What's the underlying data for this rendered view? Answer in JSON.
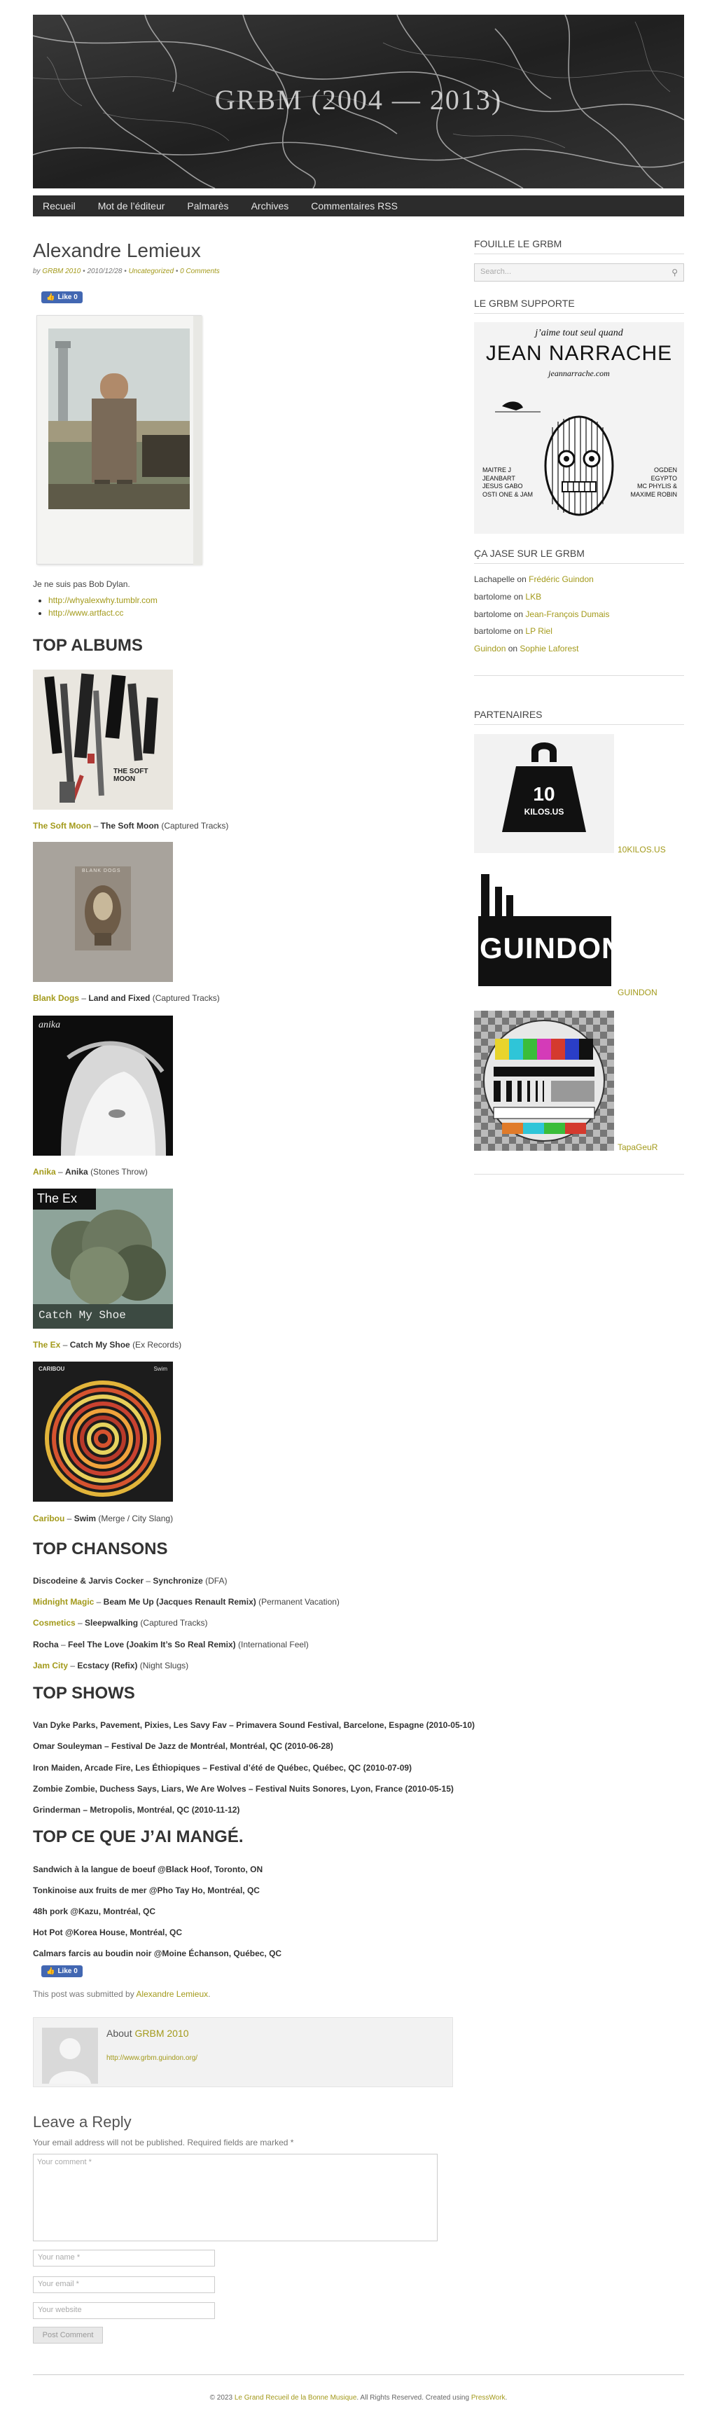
{
  "site": {
    "title": "GRBM (2004 — 2013)"
  },
  "nav": [
    "Recueil",
    "Mot de l’éditeur",
    "Palmarès",
    "Archives",
    "Commentaires RSS"
  ],
  "post": {
    "title": "Alexandre Lemieux",
    "meta_by": "by",
    "meta_author": "GRBM 2010",
    "meta_date": "2010/12/28",
    "meta_category": "Uncategorized",
    "meta_comments": "0 Comments",
    "fb_like": "Like 0",
    "intro": "Je ne suis pas Bob Dylan.",
    "links": [
      "http://whyalexwhy.tumblr.com",
      "http://www.artfact.cc"
    ],
    "top_albums_heading": "TOP ALBUMS",
    "albums": [
      {
        "artist": "The Soft Moon",
        "title": "The Soft Moon",
        "label": "(Captured Tracks)",
        "cover_text": "THE SOFT MOON"
      },
      {
        "artist": "Blank Dogs",
        "title": "Land and Fixed",
        "label": "(Captured Tracks)",
        "cover_text": "BLANK DOGS"
      },
      {
        "artist": "Anika",
        "title": "Anika",
        "label": "(Stones Throw)",
        "cover_text": "anika"
      },
      {
        "artist": "The Ex",
        "title": "Catch My Shoe",
        "label": "(Ex Records)",
        "cover_text": "The Ex",
        "cover_sub": "Catch My Shoe"
      },
      {
        "artist": "Caribou",
        "title": "Swim",
        "label": "(Merge / City Slang)",
        "cover_text": "CARIBOU",
        "cover_sub": "Swim"
      }
    ],
    "top_chansons_heading": "TOP CHANSONS",
    "chansons": [
      {
        "artist": "Discodeine & Jarvis Cocker",
        "artist_link": false,
        "title": "Synchronize",
        "label": "(DFA)"
      },
      {
        "artist": "Midnight Magic",
        "artist_link": true,
        "title": "Beam Me Up (Jacques Renault Remix)",
        "label": "(Permanent Vacation)"
      },
      {
        "artist": "Cosmetics",
        "artist_link": true,
        "title": "Sleepwalking",
        "label": "(Captured Tracks)"
      },
      {
        "artist": "Rocha",
        "artist_link": false,
        "title": "Feel The Love (Joakim It’s So Real Remix)",
        "label": "(International Feel)"
      },
      {
        "artist": "Jam City",
        "artist_link": true,
        "title": "Ecstacy (Refix)",
        "label": "(Night Slugs)"
      }
    ],
    "top_shows_heading": "TOP SHOWS",
    "shows": [
      "Van Dyke Parks, Pavement, Pixies, Les Savy Fav – Primavera Sound Festival, Barcelone, Espagne (2010-05-10)",
      "Omar Souleyman – Festival De Jazz de Montréal, Montréal, QC (2010-06-28)",
      "Iron Maiden, Arcade Fire, Les Éthiopiques – Festival d’été de Québec, Québec, QC (2010-07-09)",
      "Zombie Zombie, Duchess Says, Liars, We Are Wolves – Festival Nuits Sonores, Lyon, France (2010-05-15)",
      "Grinderman – Metropolis, Montréal, QC (2010-11-12)"
    ],
    "top_mange_heading": "TOP CE QUE J’AI MANGÉ.",
    "mange": [
      "Sandwich à la langue de boeuf @Black Hoof, Toronto, ON",
      "Tonkinoise aux fruits de mer @Pho Tay Ho, Montréal, QC",
      "48h pork @Kazu, Montréal, QC",
      "Hot Pot @Korea House, Montréal, QC",
      "Calmars farcis au boudin noir @Moine Échanson, Québec, QC"
    ],
    "fb_like2": "Like 0",
    "submitted_prefix": "This post was submitted by",
    "submitted_author": "Alexandre Lemieux",
    "submitted_suffix": "."
  },
  "author_box": {
    "about_prefix": "About",
    "about_name": "GRBM 2010",
    "url": "http://www.grbm.guindon.org/"
  },
  "reply": {
    "title": "Leave a Reply",
    "note": "Your email address will not be published. Required fields are marked *",
    "comment_placeholder": "Your comment *",
    "name_placeholder": "Your name *",
    "email_placeholder": "Your email *",
    "website_placeholder": "Your website",
    "submit": "Post Comment"
  },
  "sidebar": {
    "search_title": "FOUILLE LE GRBM",
    "search_placeholder": "Search...",
    "supporte_title": "LE GRBM SUPPORTE",
    "poster": {
      "top": "j’aime tout seul quand",
      "name": "JEAN NARRACHE",
      "site": "jeannarrache.com",
      "left_names": [
        "MAITRE J",
        "JEANBART",
        "JESUS GABO",
        "OSTI ONE & JAM"
      ],
      "right_names": [
        "OGDEN",
        "EGYPTO",
        "MC PHYLIS &",
        "MAXIME ROBIN"
      ]
    },
    "jase_title": "ÇA JASE SUR LE GRBM",
    "comments": [
      {
        "who": "Lachapelle",
        "on": "on",
        "post": "Frédéric Guindon"
      },
      {
        "who": "bartolome",
        "on": "on",
        "post": "LKB"
      },
      {
        "who": "bartolome",
        "on": "on",
        "post": "Jean-François Dumais"
      },
      {
        "who": "bartolome",
        "on": "on",
        "post": "LP Riel"
      },
      {
        "who": "Guindon",
        "on": "on",
        "post": "Sophie Laforest",
        "who_link": true
      }
    ],
    "partenaires_title": "PARTENAIRES",
    "partners": [
      {
        "label": "10KILOS.US",
        "logo_text": "10",
        "logo_sub": "KILOS.US"
      },
      {
        "label": "GUINDON",
        "logo_text": "GUINDON"
      },
      {
        "label": "TapaGeuR"
      }
    ]
  },
  "footer": {
    "copy": "© 2023",
    "site_link": "Le Grand Recueil de la Bonne Musique",
    "rights": ". All Rights Reserved. Created using",
    "engine": "PressWork",
    "end": "."
  },
  "colors": {
    "accent": "#a39a1b",
    "nav_bg": "#2c2c2c",
    "fb_blue": "#4267b2"
  }
}
